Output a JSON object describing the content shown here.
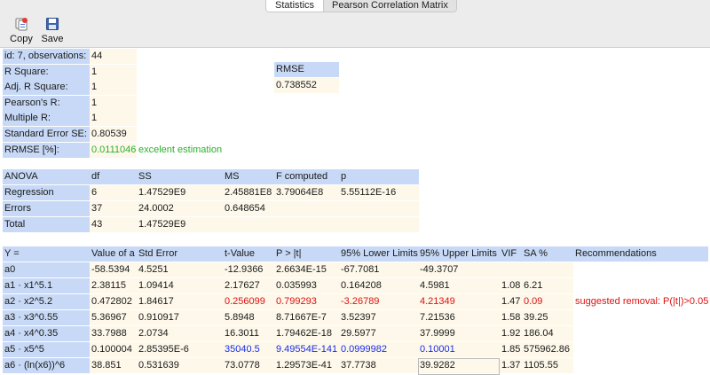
{
  "tabs": [
    "Statistics",
    "Pearson Correlation Matrix"
  ],
  "toolbar": {
    "copy_label": "Copy",
    "save_label": "Save"
  },
  "summary": {
    "labels": [
      "id: 7, observations:",
      "R Square:",
      "Adj. R Square:",
      "Pearson's R:",
      "Multiple R:",
      "Standard Error SE:",
      "RRMSE [%]:"
    ],
    "values": [
      "44",
      "1",
      "1",
      "1",
      "1",
      "0.80539",
      "0.0111046"
    ],
    "rrmse_note": "excelent estimation"
  },
  "rmse": {
    "label": "RMSE",
    "value": "0.738552"
  },
  "anova": {
    "headers": [
      "ANOVA",
      "df",
      "SS",
      "MS",
      "F computed",
      "p"
    ],
    "rows": [
      [
        "Regression",
        "6",
        "1.47529E9",
        "2.45881E8",
        "3.79064E8",
        "5.55112E-16"
      ],
      [
        "Errors",
        "37",
        "24.0002",
        "0.648654",
        "",
        ""
      ],
      [
        "Total",
        "43",
        "1.47529E9",
        "",
        "",
        ""
      ]
    ]
  },
  "coef": {
    "headers": [
      "Y =",
      "Value of a",
      "Std Error",
      "t-Value",
      "P > |t|",
      "95% Lower Limits",
      "95% Upper Limits",
      "VIF",
      "SA %",
      "Recommendations"
    ],
    "rows": [
      [
        "a0",
        "-58.5394",
        "4.5251",
        "-12.9366",
        "2.6634E-15",
        "-67.7081",
        "-49.3707",
        "",
        "",
        ""
      ],
      [
        "a1 · x1^5.1",
        "2.38115",
        "1.09414",
        "2.17627",
        "0.035993",
        "0.164208",
        "4.5981",
        "1.08",
        "6.21",
        ""
      ],
      [
        "a2 · x2^5.2",
        "0.472802",
        "1.84617",
        "0.256099",
        "0.799293",
        "-3.26789",
        "4.21349",
        "1.47",
        "0.09",
        "suggested removal: P(|t|)>0.05"
      ],
      [
        "a3 · x3^0.55",
        "5.36967",
        "0.910917",
        "5.8948",
        "8.71667E-7",
        "3.52397",
        "7.21536",
        "1.58",
        "39.25",
        ""
      ],
      [
        "a4 · x4^0.35",
        "33.7988",
        "2.0734",
        "16.3011",
        "1.79462E-18",
        "29.5977",
        "37.9999",
        "1.92",
        "186.04",
        ""
      ],
      [
        "a5 · x5^5",
        "0.100004",
        "2.85395E-6",
        "35040.5",
        "9.49554E-141",
        "0.0999982",
        "0.10001",
        "1.85",
        "575962.86",
        ""
      ],
      [
        "a6 · (ln(x6))^6",
        "38.851",
        "0.531639",
        "73.0778",
        "1.29573E-41",
        "37.7738",
        "39.9282",
        "1.37",
        "1105.55",
        ""
      ]
    ]
  },
  "colors": {
    "header_bg": "#c7d9f6",
    "value_bg": "#fdf8ea",
    "good": "#2bb02b",
    "bad": "#e01010",
    "highlight": "#1a2de6"
  }
}
